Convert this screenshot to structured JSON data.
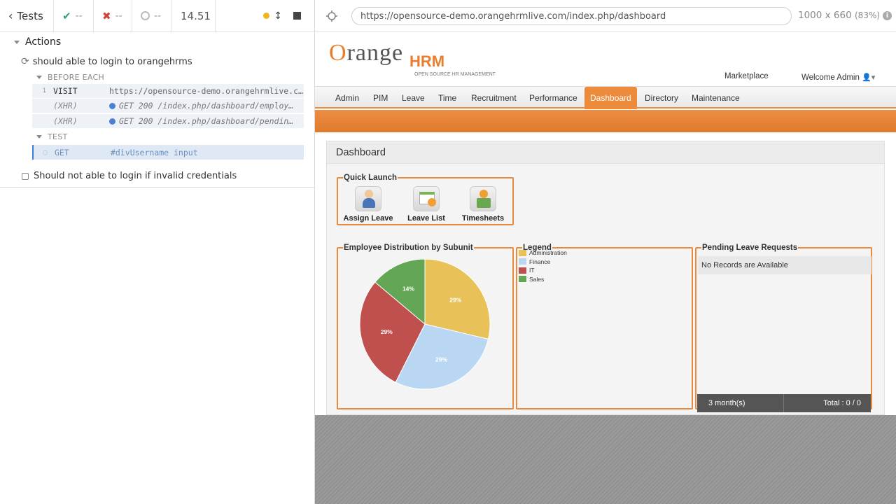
{
  "reporter": {
    "back_label": "Tests",
    "passed": "--",
    "failed": "--",
    "pending": "--",
    "duration": "14.51",
    "section_title": "Actions",
    "test1_title": "should able to login to orangehrms",
    "hook_before_each": "BEFORE EACH",
    "hook_test": "TEST",
    "commands": [
      {
        "num": "1",
        "name": "VISIT",
        "message": "https://opensource-demo.orangehrmlive.com/ …"
      },
      {
        "num": "",
        "name": "(XHR)",
        "message": "GET 200 /index.php/dashboard/employ…"
      },
      {
        "num": "",
        "name": "(XHR)",
        "message": "GET 200 /index.php/dashboard/pendin…"
      }
    ],
    "active_command": {
      "name": "GET",
      "message": "#divUsername input"
    },
    "test2_title": "Should not able to login if invalid credentials"
  },
  "aut": {
    "url": "https://opensource-demo.orangehrmlive.com/index.php/dashboard",
    "viewport": "1000 x 660",
    "scale": "(83%)"
  },
  "app": {
    "logo_o": "O",
    "logo_range": "range",
    "logo_hrm": "HRM",
    "logo_tagline": "OPEN SOURCE HR MANAGEMENT",
    "marketplace": "Marketplace",
    "welcome": "Welcome Admin",
    "menu": [
      "Admin",
      "PIM",
      "Leave",
      "Time",
      "Recruitment",
      "Performance",
      "Dashboard",
      "Directory",
      "Maintenance"
    ],
    "active_menu": "Dashboard",
    "dashboard_title": "Dashboard",
    "quick_launch": {
      "title": "Quick Launch",
      "items": [
        "Assign Leave",
        "Leave List",
        "Timesheets"
      ]
    },
    "distribution_title": "Employee Distribution by Subunit",
    "legend_title": "Legend",
    "pending": {
      "title": "Pending Leave Requests",
      "empty": "No Records are Available",
      "period": "3 month(s)",
      "total": "Total : 0 / 0"
    }
  },
  "chart_data": {
    "type": "pie",
    "title": "Employee Distribution by Subunit",
    "categories": [
      "Administration",
      "Finance",
      "IT",
      "Sales"
    ],
    "values": [
      29,
      29,
      29,
      14
    ],
    "labels": [
      "29%",
      "29%",
      "29%",
      "14%"
    ],
    "colors": [
      "#e8c158",
      "#b9d7f3",
      "#c0504d",
      "#62a656"
    ]
  }
}
